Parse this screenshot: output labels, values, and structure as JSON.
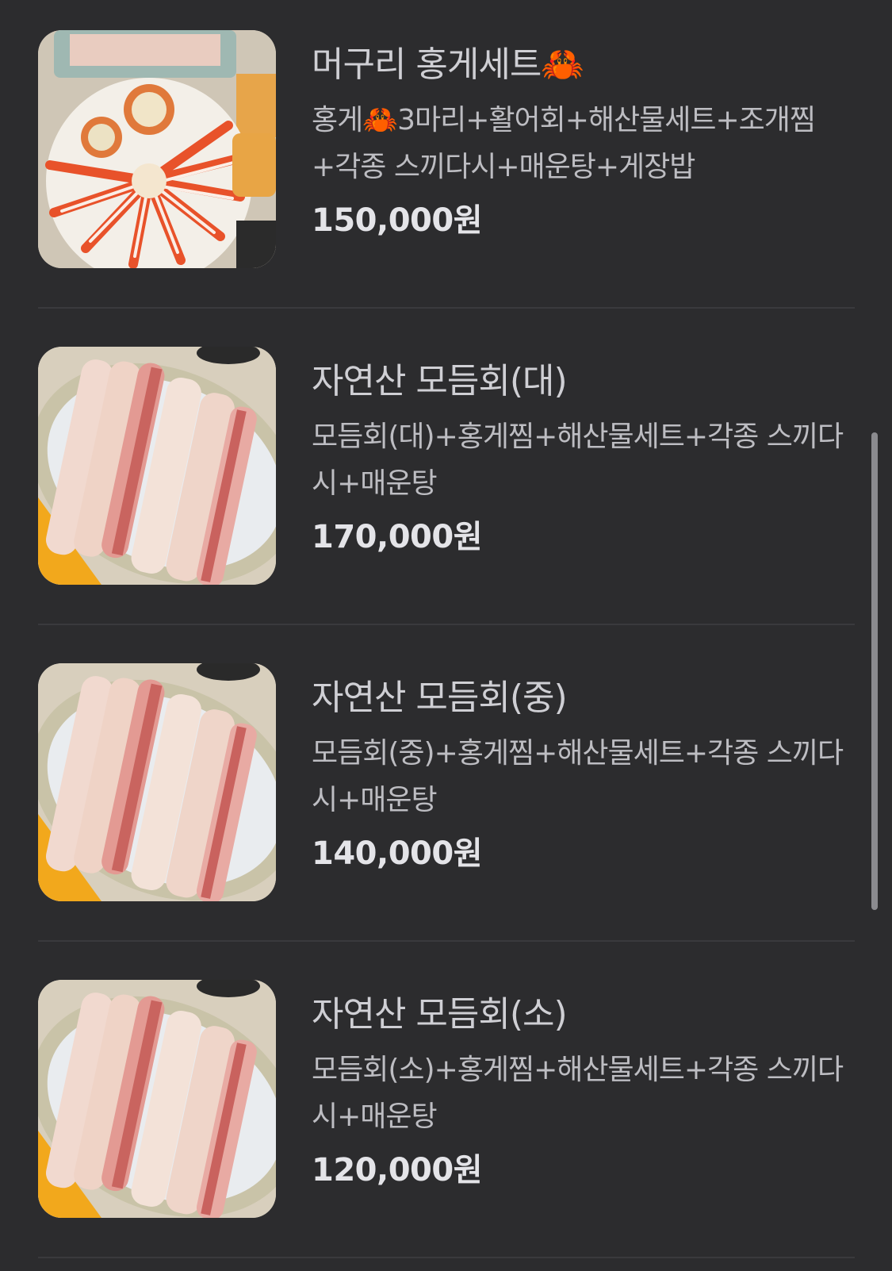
{
  "menu": {
    "items": [
      {
        "name": "머구리 홍게세트🦀",
        "description": "홍게🦀3마리+활어회+해산물세트+조개찜+각종 스끼다시+매운탕+게장밥",
        "price": "150,000원",
        "image_icon": "crab-platter-photo"
      },
      {
        "name": "자연산 모듬회(대)",
        "description": "모듬회(대)+홍게찜+해산물세트+각종 스끼다시+매운탕",
        "price": "170,000원",
        "image_icon": "sashimi-platter-photo"
      },
      {
        "name": "자연산 모듬회(중)",
        "description": "모듬회(중)+홍게찜+해산물세트+각종 스끼다시+매운탕",
        "price": "140,000원",
        "image_icon": "sashimi-platter-photo"
      },
      {
        "name": "자연산 모듬회(소)",
        "description": "모듬회(소)+홍게찜+해산물세트+각종 스끼다시+매운탕",
        "price": "120,000원",
        "image_icon": "sashimi-platter-photo"
      }
    ]
  },
  "colors": {
    "background": "#2c2c2e",
    "divider": "#3a3a3d",
    "name_text": "#cfcfd4",
    "price_text": "#e4e4e8"
  }
}
